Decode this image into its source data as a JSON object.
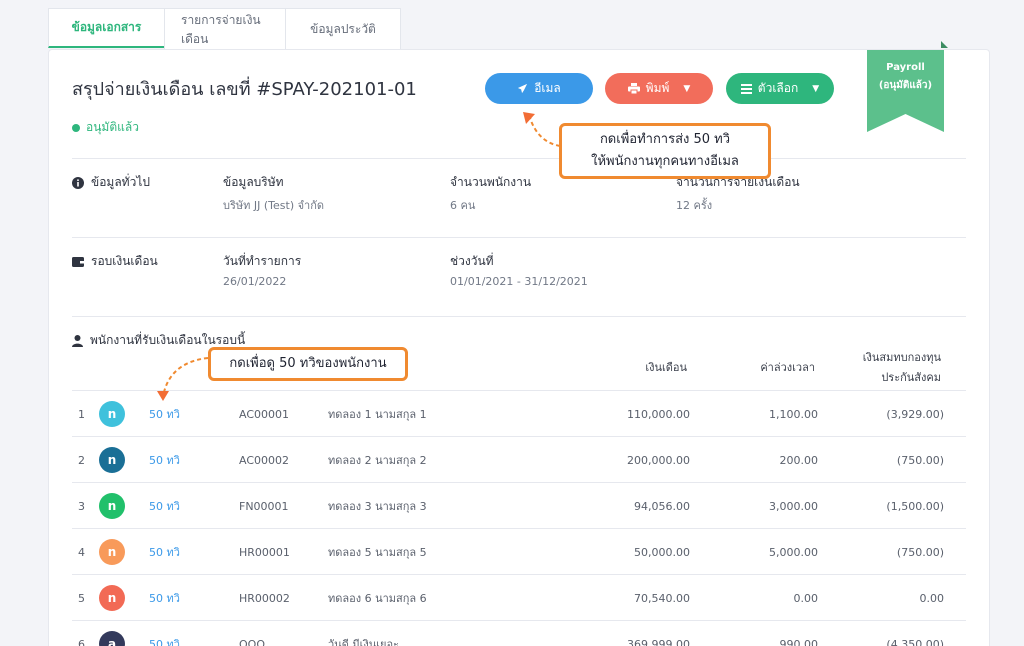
{
  "tabs": [
    {
      "label": "ข้อมูลเอกสาร",
      "active": true
    },
    {
      "label": "รายการจ่ายเงินเดือน",
      "active": false
    },
    {
      "label": "ข้อมูลประวัติ",
      "active": false
    }
  ],
  "header": {
    "title": "สรุปจ่ายเงินเดือน เลขที่ #SPAY-202101-01",
    "status": "อนุมัติแล้ว",
    "email_label": "อีเมล",
    "print_label": "พิมพ์",
    "options_label": "ตัวเลือก"
  },
  "ribbon": {
    "line1": "Payroll",
    "line2": "(อนุมัติแล้ว)"
  },
  "general": {
    "section": "ข้อมูลทั่วไป",
    "company_label": "ข้อมูลบริษัท",
    "company_value": "บริษัท JJ (Test) จำกัด",
    "employees_label": "จำนวนพนักงาน",
    "employees_value": "6 คน",
    "payments_label": "จำนวนการจ่ายเงินเดือน",
    "payments_value": "12 ครั้ง"
  },
  "cycle": {
    "section": "รอบเงินเดือน",
    "date_label": "วันที่ทำรายการ",
    "date_value": "26/01/2022",
    "range_label": "ช่วงวันที่",
    "range_value": "01/01/2021 - 31/12/2021"
  },
  "employees": {
    "section": "พนักงานที่รับเงินเดือนในรอบนี้",
    "col_salary": "เงินเดือน",
    "col_overtime": "ค่าล่วงเวลา",
    "col_ss_line1": "เงินสมทบกองทุน",
    "col_ss_line2": "ประกันสังคม",
    "rows": [
      {
        "idx": "1",
        "initial": "n",
        "color": "#3fc1dc",
        "link": "50 ทวิ",
        "code": "AC00001",
        "name": "ทดลอง 1 นามสกุล 1",
        "salary": "110,000.00",
        "overtime": "1,100.00",
        "ss": "(3,929.00)"
      },
      {
        "idx": "2",
        "initial": "n",
        "color": "#1a6f96",
        "link": "50 ทวิ",
        "code": "AC00002",
        "name": "ทดลอง 2 นามสกุล 2",
        "salary": "200,000.00",
        "overtime": "200.00",
        "ss": "(750.00)"
      },
      {
        "idx": "3",
        "initial": "n",
        "color": "#21c06b",
        "link": "50 ทวิ",
        "code": "FN00001",
        "name": "ทดลอง 3 นามสกุล 3",
        "salary": "94,056.00",
        "overtime": "3,000.00",
        "ss": "(1,500.00)"
      },
      {
        "idx": "4",
        "initial": "n",
        "color": "#f89a5a",
        "link": "50 ทวิ",
        "code": "HR00001",
        "name": "ทดลอง 5 นามสกุล 5",
        "salary": "50,000.00",
        "overtime": "5,000.00",
        "ss": "(750.00)"
      },
      {
        "idx": "5",
        "initial": "n",
        "color": "#f26a55",
        "link": "50 ทวิ",
        "code": "HR00002",
        "name": "ทดลอง 6 นามสกุล 6",
        "salary": "70,540.00",
        "overtime": "0.00",
        "ss": "0.00"
      },
      {
        "idx": "6",
        "initial": "a",
        "color": "#333a5c",
        "link": "50 ทวิ",
        "code": "OOO",
        "name": "วันดี มีเงินเยอะ",
        "salary": "369,999.00",
        "overtime": "990.00",
        "ss": "(4,350.00)"
      }
    ]
  },
  "callouts": {
    "email_line1": "กดเพื่อทำการส่ง 50 ทวิ",
    "email_line2": "ให้พนักงานทุกคนทางอีเมล",
    "view": "กดเพื่อดู 50 ทวิของพนักงาน",
    "accent": "#f08a30"
  }
}
